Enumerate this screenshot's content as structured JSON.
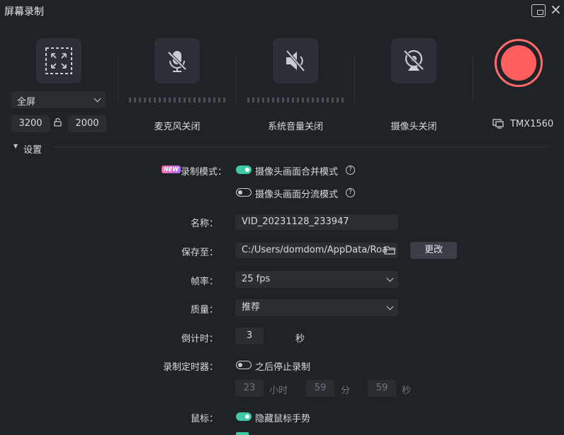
{
  "window": {
    "title": "屏幕录制",
    "close": "×"
  },
  "capture": {
    "area_mode": "全屏",
    "width": "3200",
    "height": "2000",
    "mic_label": "麦克风关闭",
    "sys_audio_label": "系统音量关闭",
    "camera_label": "摄像头关闭",
    "monitor_label": "TMX1560"
  },
  "settings": {
    "section_label": "设置",
    "record_mode": {
      "label": "录制模式：",
      "badge": "NEW",
      "merge_option": "摄像头画面合并模式",
      "split_option": "摄像头画面分流模式",
      "help": "?"
    },
    "name": {
      "label": "名称：",
      "value": "VID_20231128_233947"
    },
    "save_to": {
      "label": "保存至：",
      "value": "C:/Users/domdom/AppData/Roa",
      "change_button": "更改"
    },
    "fps": {
      "label": "帧率：",
      "value": "25 fps"
    },
    "quality": {
      "label": "质量：",
      "value": "推荐"
    },
    "countdown": {
      "label": "倒计时：",
      "value": "3",
      "unit": "秒"
    },
    "timer": {
      "label": "录制定时器：",
      "option": "之后停止录制",
      "hours": "23",
      "hours_unit": "小时",
      "minutes": "59",
      "minutes_unit": "分",
      "seconds": "59",
      "seconds_unit": "秒"
    },
    "mouse": {
      "label": "鼠标：",
      "option": "隐藏鼠标手势"
    }
  },
  "colors": {
    "accent": "#3ec9a7",
    "record": "#ff5e5e",
    "background": "#1f2226"
  }
}
